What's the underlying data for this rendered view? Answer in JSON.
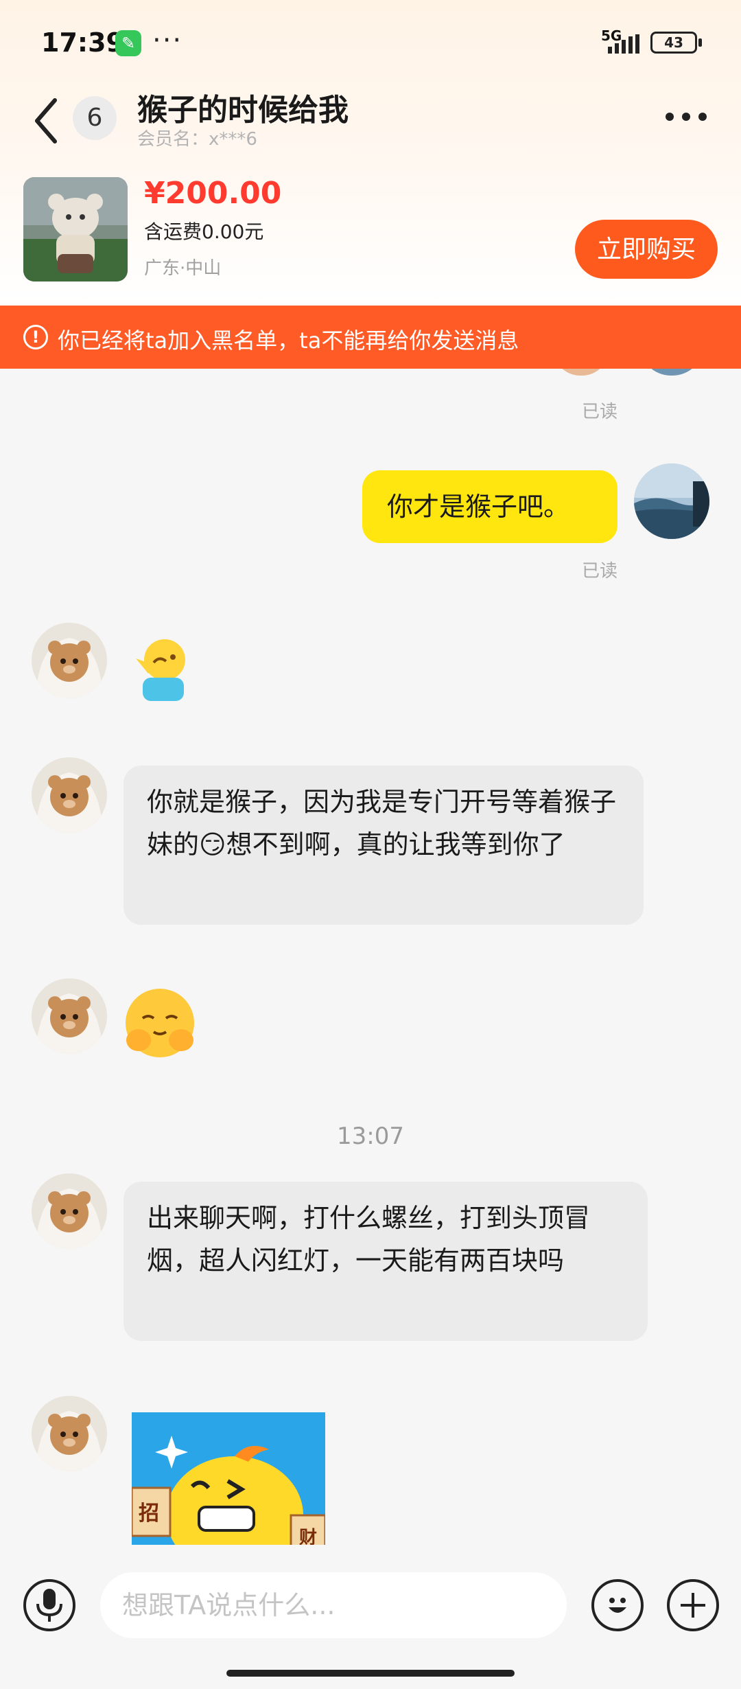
{
  "status": {
    "time": "17:39",
    "network": "5G",
    "battery": "43"
  },
  "header": {
    "unread_count": "6",
    "title": "猴子的时候给我",
    "member_label": "会员名：x***6"
  },
  "product": {
    "price": "¥200.00",
    "shipping": "含运费0.00元",
    "location": "广东·中山",
    "buy_label": "立即购买"
  },
  "warning": {
    "text": "你已经将ta加入黑名单，ta不能再给你发送消息"
  },
  "messages": {
    "read_1": "已读",
    "self_text": "你才是猴子吧。",
    "read_2": "已读",
    "other_text_1": "你就是猴子，因为我是专门开号等着猴子妹的😏想不到啊，真的让我等到你了",
    "time_divider": "13:07",
    "other_text_2": "出来聊天啊，打什么螺丝，打到头顶冒烟，超人闪红灯，一天能有两百块吗",
    "sticker_text_left": "招",
    "sticker_text_right": "财"
  },
  "composer": {
    "placeholder": "想跟TA说点什么..."
  },
  "colors": {
    "accent": "#ff5a1e",
    "price": "#ff3b30",
    "self_bubble": "#ffe60f",
    "warning_bg": "#ff5b26"
  }
}
